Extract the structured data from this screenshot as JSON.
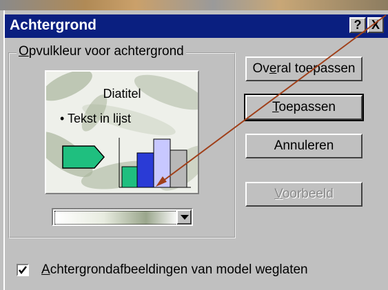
{
  "dialog": {
    "title": "Achtergrond",
    "help_label": "?",
    "close_label": "X"
  },
  "group": {
    "label_access": "O",
    "label_rest": "pvulkleur voor achtergrond"
  },
  "preview": {
    "slide_title": "Diatitel",
    "bullet": "• Tekst in lijst"
  },
  "buttons": {
    "apply_all_a": "Ov",
    "apply_all_access": "e",
    "apply_all_b": "ral toepassen",
    "apply_access": "T",
    "apply_rest": "oepassen",
    "cancel": "Annuleren",
    "preview_access": "V",
    "preview_rest": "oorbeeld"
  },
  "checkbox": {
    "checked": true,
    "label_access": "A",
    "label_rest": "chtergrondafbeeldingen van model weglaten"
  },
  "colors": {
    "titlebar": "#0a1f80",
    "face": "#c0c0c0",
    "annotation_arrow": "#a0401a"
  }
}
